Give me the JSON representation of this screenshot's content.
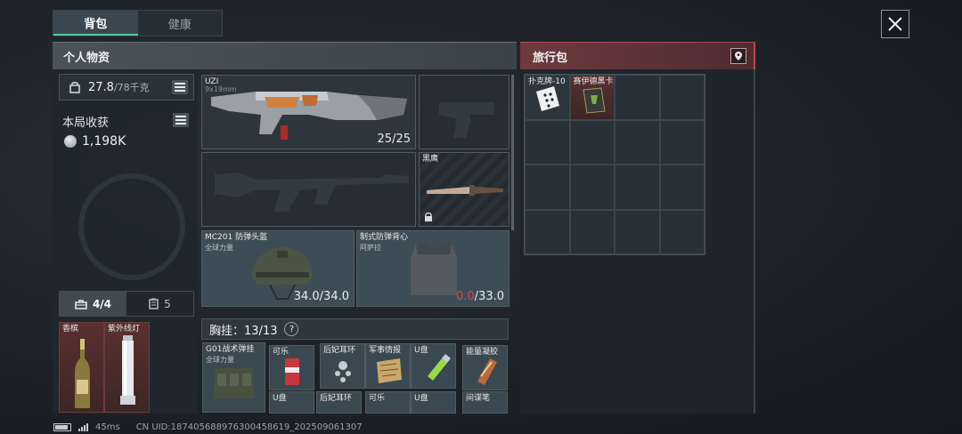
{
  "tabs": {
    "backpack": "背包",
    "health": "健康"
  },
  "personal": {
    "title": "个人物资",
    "weight_current": "27.8",
    "weight_max": "/78千克",
    "income_label": "本局收获",
    "income_value": "1,198K"
  },
  "travel": {
    "title": "旅行包"
  },
  "weapons": {
    "primary": {
      "name": "UZI",
      "caliber": "9x19mm",
      "ammo": "25/25"
    },
    "melee": {
      "name": "黑鹰"
    }
  },
  "armor": {
    "helmet": {
      "name": "MC201 防弹头盔",
      "maker": "全球力量",
      "current": "34.0",
      "max": "/34.0"
    },
    "vest": {
      "name": "制式防弹背心",
      "maker": "阿萨拉",
      "current": "0.0",
      "max": "/33.0"
    }
  },
  "pocket_tabs": {
    "tab1": "4/4",
    "tab2": "5"
  },
  "pocket_items": [
    {
      "name": "香槟"
    },
    {
      "name": "紫外线灯"
    }
  ],
  "chest": {
    "label": "胸挂：",
    "count": "13/13",
    "help": "?",
    "rig": {
      "name": "G01战术弹挂",
      "maker": "全球力量"
    },
    "items": [
      {
        "name": "可乐"
      },
      {
        "name": "后妃耳环"
      },
      {
        "name": "军事情报"
      },
      {
        "name": "U盘"
      },
      {
        "name": "能量凝胶"
      },
      {
        "name": "U盘"
      },
      {
        "name": "后妃耳环"
      },
      {
        "name": "可乐"
      },
      {
        "name": "U盘"
      },
      {
        "name": "间谍笔"
      }
    ]
  },
  "travel_items": [
    {
      "name": "扑克牌-10"
    },
    {
      "name": "赛伊德黑卡"
    }
  ],
  "status": {
    "ping": "45ms",
    "uid": "CN UID:187405688976300458619_202509061307"
  },
  "colors": {
    "accent": "#58c8b0",
    "travel_red": "#c0444e",
    "warning": "#e0443e"
  }
}
